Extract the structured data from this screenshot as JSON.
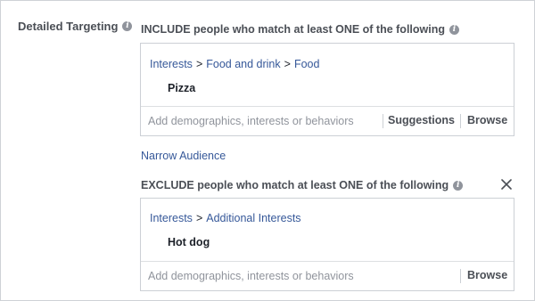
{
  "detailed_targeting": {
    "label": "Detailed Targeting",
    "info_icon": "info-icon"
  },
  "include": {
    "title": "INCLUDE people who match at least ONE of the following",
    "breadcrumb": [
      "Interests",
      "Food and drink",
      "Food"
    ],
    "separator": ">",
    "item": "Pizza",
    "search_placeholder": "Add demographics, interests or behaviors",
    "suggestions_label": "Suggestions",
    "browse_label": "Browse"
  },
  "narrow_audience_label": "Narrow Audience",
  "exclude": {
    "title": "EXCLUDE people who match at least ONE of the following",
    "breadcrumb": [
      "Interests",
      "Additional Interests"
    ],
    "separator": ">",
    "item": "Hot dog",
    "search_placeholder": "Add demographics, interests or behaviors",
    "browse_label": "Browse",
    "close_icon": "close-icon"
  },
  "colors": {
    "link": "#365899",
    "label": "#4b4f56",
    "placeholder": "#90949c",
    "border": "#ccd0d5"
  }
}
